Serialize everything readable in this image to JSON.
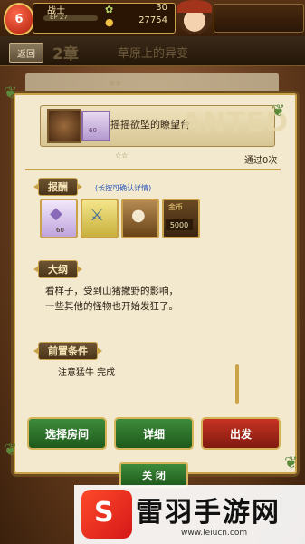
{
  "status": {
    "level": "6",
    "class_name": "战士",
    "exp_text": "EP 27",
    "stamina": "30",
    "gold": "27754"
  },
  "chapter": {
    "back_label": "返回",
    "number": "2章",
    "title": "草原上的异变"
  },
  "stage": {
    "name": "摇摇欲坠的瞭望台",
    "thumb_count": "60",
    "watermark": "ANTED",
    "stars": "☆☆",
    "clear_count": "通过0次"
  },
  "rewards": {
    "label": "报酬",
    "hint": "(长按可确认详情)",
    "crystal_count": "60",
    "gold_label": "金币",
    "gold_amount": "5000"
  },
  "outline": {
    "label": "大纲",
    "line1": "看样子，受到山猪撒野的影响，",
    "line2": "一些其他的怪物也开始发狂了。"
  },
  "prerequisite": {
    "label": "前置条件",
    "text": "注意猛牛 完成"
  },
  "buttons": {
    "select_room": "选择房间",
    "detail": "详细",
    "go": "出发",
    "close": "关 闭"
  },
  "brand": {
    "name": "雷羽手游网",
    "url": "www.leiucn.com"
  },
  "icons": [
    "level-badge-icon",
    "leaf-icon",
    "coin-icon",
    "crystal-icon",
    "sword-icon",
    "bag-icon",
    "gold-icon"
  ]
}
